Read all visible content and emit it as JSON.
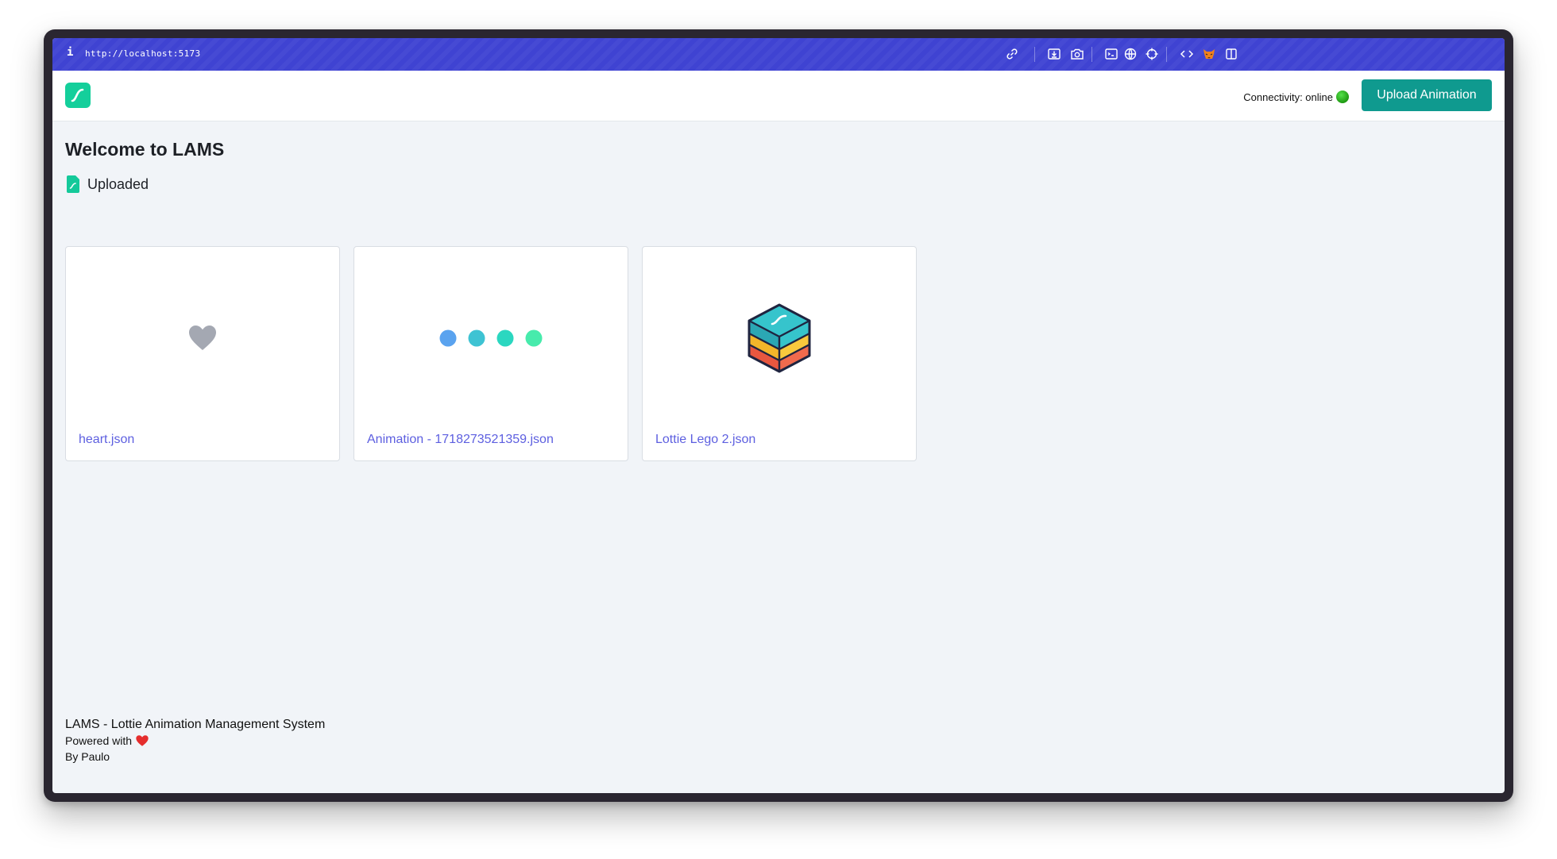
{
  "browser": {
    "url": "http://localhost:5173",
    "info_glyph": "i",
    "icons": [
      "link-icon",
      "download-icon",
      "camera-icon",
      "terminal-icon",
      "globe-icon",
      "crosshair-icon",
      "code-icon",
      "fox-extension-icon",
      "sidebar-icon"
    ]
  },
  "header": {
    "connectivity_label": "Connectivity: online",
    "upload_button": "Upload Animation",
    "status_color": "#2ab41f",
    "accent": "#0f9a8f"
  },
  "main": {
    "welcome": "Welcome to LAMS",
    "section_title": "Uploaded"
  },
  "cards": [
    {
      "title": "heart.json",
      "preview": "heart-animation"
    },
    {
      "title": "Animation - 1718273521359.json",
      "preview": "dots-animation"
    },
    {
      "title": "Lottie Lego 2.json",
      "preview": "lego-cube-animation"
    }
  ],
  "footer": {
    "title": "LAMS - Lottie Animation Management System",
    "powered_with": "Powered with",
    "by": "By Paulo"
  }
}
